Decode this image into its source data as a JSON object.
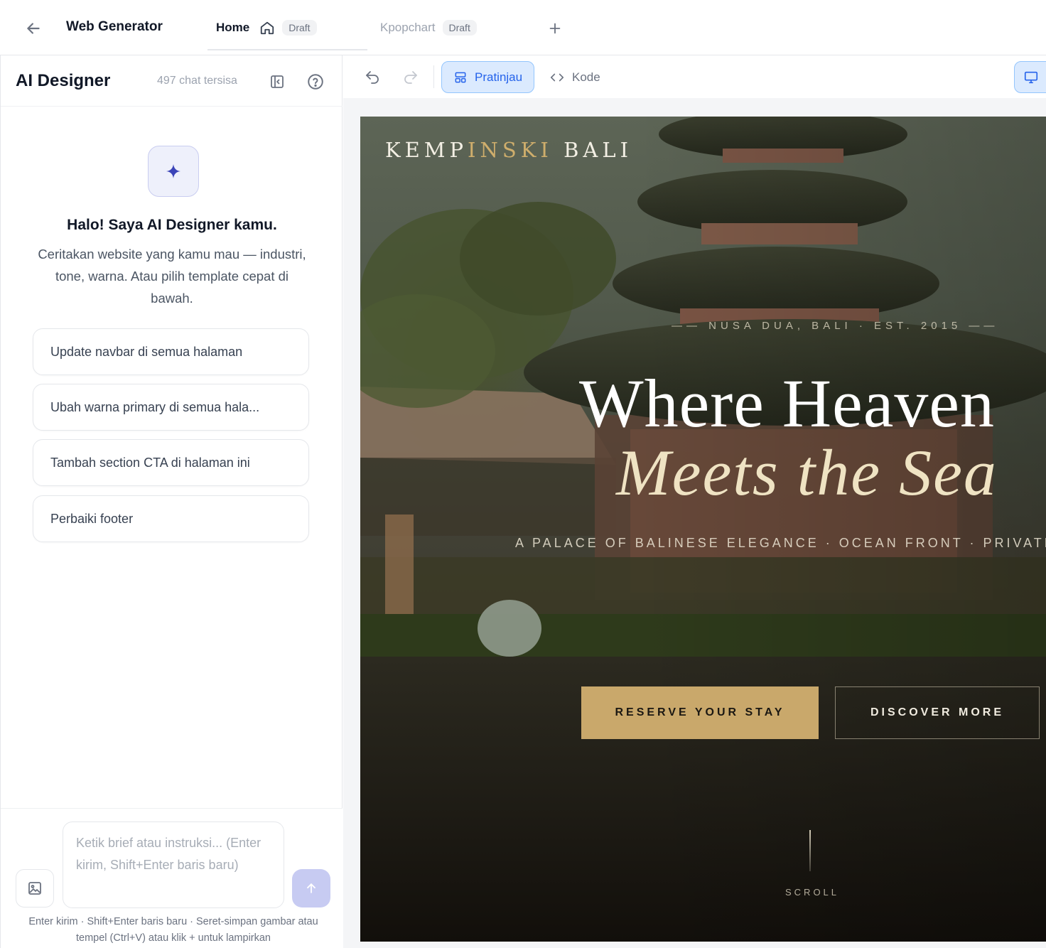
{
  "topbar": {
    "app_title": "Web Generator",
    "tabs": [
      {
        "label": "Home",
        "badge": "Draft",
        "icon": "home-icon",
        "active": true
      },
      {
        "label": "Kpopchart",
        "badge": "Draft",
        "active": false
      }
    ]
  },
  "left_panel": {
    "title": "AI Designer",
    "chat_remaining": "497 chat tersisa",
    "greeting": "Halo! Saya AI Designer kamu.",
    "description": "Ceritakan website yang kamu mau — industri, tone, warna. Atau pilih template cepat di bawah.",
    "suggestions": [
      "Update navbar di semua halaman",
      "Ubah warna primary di semua hala...",
      "Tambah section CTA di halaman ini",
      "Perbaiki footer"
    ],
    "composer": {
      "placeholder": "Ketik brief atau instruksi... (Enter kirim, Shift+Enter baris baru)",
      "value": "",
      "hint": "Enter kirim · Shift+Enter baris baru · Seret-simpan gambar atau tempel (Ctrl+V) atau klik + untuk lampirkan"
    }
  },
  "toolbar": {
    "preview_label": "Pratinjau",
    "code_label": "Kode",
    "active_mode": "Pratinjau"
  },
  "hero": {
    "brand_part1": "KEMP",
    "brand_part2": "INSKI",
    "brand_part3": " BALI",
    "kicker": "—— NUSA DUA, BALI · EST. 2015 ——",
    "headline_line1": "Where Heaven",
    "headline_line2": "Meets the Sea",
    "subline": "A PALACE OF BALINESE ELEGANCE · OCEAN FRONT · PRIVATE",
    "cta_primary": "RESERVE YOUR STAY",
    "cta_secondary": "DISCOVER MORE",
    "scroll_label": "SCROLL"
  },
  "colors": {
    "accent_blue": "#2563eb",
    "gold": "#c9a86b",
    "send_button": "#c7cbf2"
  }
}
